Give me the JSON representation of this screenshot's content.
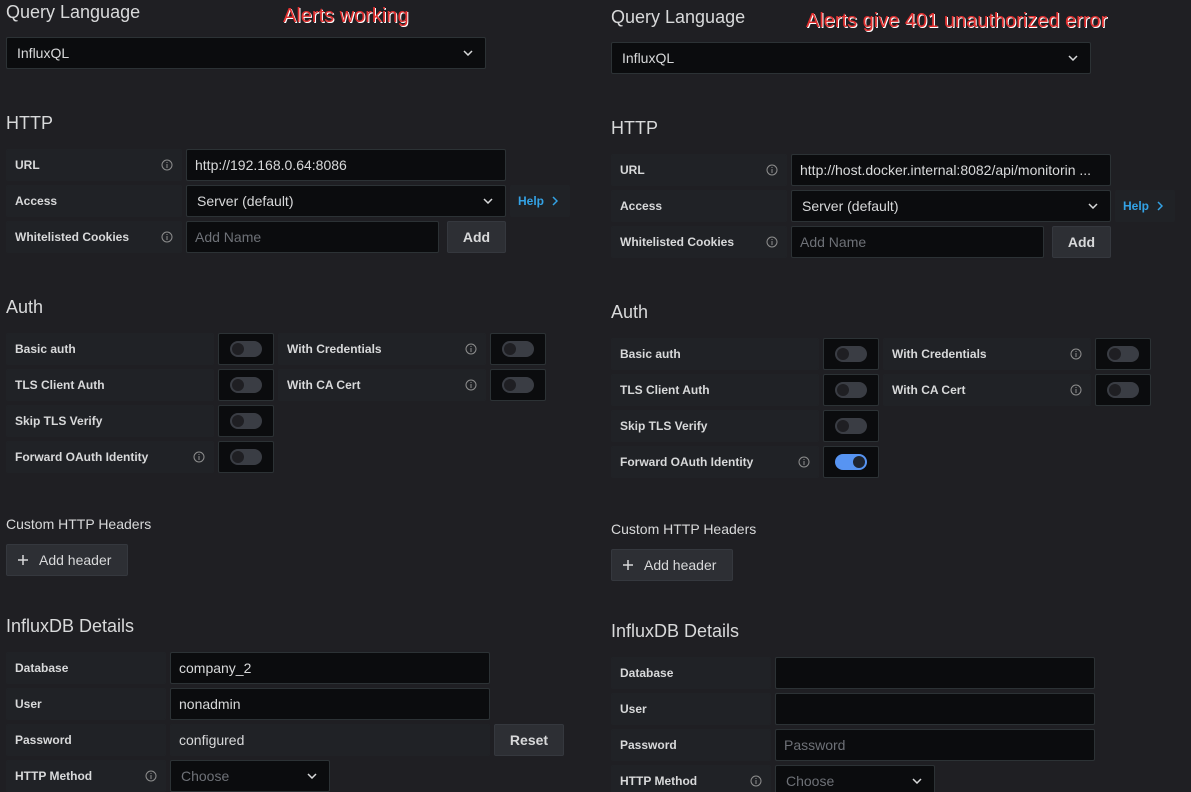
{
  "left": {
    "annotation": "Alerts working",
    "query_language": {
      "heading": "Query Language",
      "value": "InfluxQL"
    },
    "http": {
      "heading": "HTTP",
      "url_label": "URL",
      "url_value": "http://192.168.0.64:8086",
      "access_label": "Access",
      "access_value": "Server (default)",
      "help_label": "Help",
      "cookies_label": "Whitelisted Cookies",
      "cookies_placeholder": "Add Name",
      "add_label": "Add"
    },
    "auth": {
      "heading": "Auth",
      "basic_auth": "Basic auth",
      "basic_auth_on": false,
      "with_credentials": "With Credentials",
      "with_credentials_on": false,
      "tls_client_auth": "TLS Client Auth",
      "tls_client_auth_on": false,
      "with_ca_cert": "With CA Cert",
      "with_ca_cert_on": false,
      "skip_tls_verify": "Skip TLS Verify",
      "skip_tls_verify_on": false,
      "forward_oauth": "Forward OAuth Identity",
      "forward_oauth_on": false
    },
    "custom_headers": {
      "heading": "Custom HTTP Headers",
      "add_label": "Add header"
    },
    "influx": {
      "heading": "InfluxDB Details",
      "database_label": "Database",
      "database_value": "company_2",
      "user_label": "User",
      "user_value": "nonadmin",
      "password_label": "Password",
      "password_value": "configured",
      "reset_label": "Reset",
      "method_label": "HTTP Method",
      "method_placeholder": "Choose"
    }
  },
  "right": {
    "annotation": "Alerts give 401 unauthorized error",
    "query_language": {
      "heading": "Query Language",
      "value": "InfluxQL"
    },
    "http": {
      "heading": "HTTP",
      "url_label": "URL",
      "url_value": "http://host.docker.internal:8082/api/monitorin ...",
      "access_label": "Access",
      "access_value": "Server (default)",
      "help_label": "Help",
      "cookies_label": "Whitelisted Cookies",
      "cookies_placeholder": "Add Name",
      "add_label": "Add"
    },
    "auth": {
      "heading": "Auth",
      "basic_auth": "Basic auth",
      "basic_auth_on": false,
      "with_credentials": "With Credentials",
      "with_credentials_on": false,
      "tls_client_auth": "TLS Client Auth",
      "tls_client_auth_on": false,
      "with_ca_cert": "With CA Cert",
      "with_ca_cert_on": false,
      "skip_tls_verify": "Skip TLS Verify",
      "skip_tls_verify_on": false,
      "forward_oauth": "Forward OAuth Identity",
      "forward_oauth_on": true
    },
    "custom_headers": {
      "heading": "Custom HTTP Headers",
      "add_label": "Add header"
    },
    "influx": {
      "heading": "InfluxDB Details",
      "database_label": "Database",
      "database_value": "",
      "user_label": "User",
      "user_value": "",
      "password_label": "Password",
      "password_placeholder": "Password",
      "method_label": "HTTP Method",
      "method_placeholder": "Choose"
    }
  },
  "icons": {
    "info": "info-circle-icon",
    "chevron_down": "chevron-down-icon",
    "chevron_right": "chevron-right-icon",
    "plus": "plus-icon"
  },
  "colors": {
    "background": "#1f1f23",
    "annotation": "#e02f2f",
    "help_link": "#33a2e5",
    "toggle_on": "#5794f2"
  }
}
